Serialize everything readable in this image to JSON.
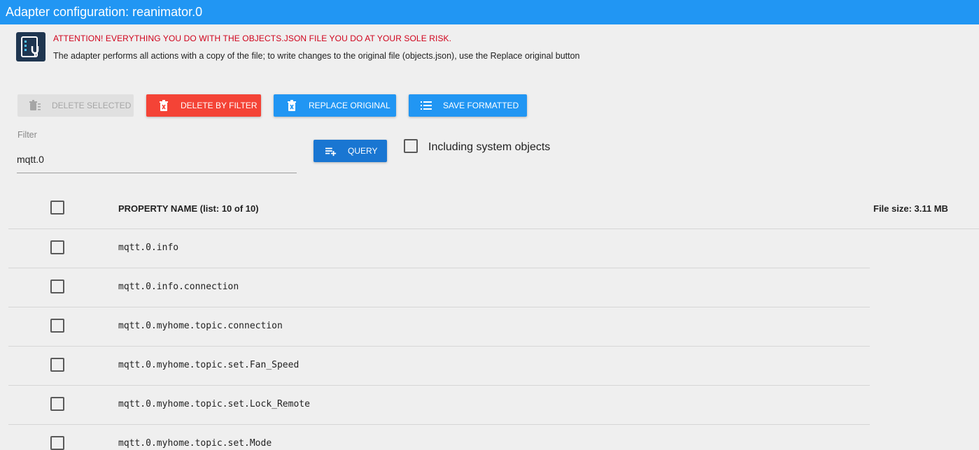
{
  "app": {
    "title": "Adapter configuration: reanimator.0"
  },
  "notice": {
    "attention": "ATTENTION! EVERYTHING YOU DO WITH THE OBJECTS.JSON FILE YOU DO AT YOUR SOLE RISK.",
    "info": "The adapter performs all actions with a copy of the file; to write changes to the original file (objects.json), use the Replace original button"
  },
  "toolbar": {
    "delete_selected": "DELETE SELECTED",
    "delete_by_filter": "DELETE BY FILTER",
    "replace_original": "REPLACE ORIGINAL",
    "save_formatted": "SAVE FORMATTED"
  },
  "filter": {
    "label": "Filter",
    "value": "mqtt.0",
    "query_label": "QUERY",
    "system_objects_label": "Including system objects"
  },
  "table": {
    "header_name": "PROPERTY NAME (list: 10 of 10)",
    "file_size": "File size: 3.11 MB",
    "rows": [
      "mqtt.0.info",
      "mqtt.0.info.connection",
      "mqtt.0.myhome.topic.connection",
      "mqtt.0.myhome.topic.set.Fan_Speed",
      "mqtt.0.myhome.topic.set.Lock_Remote",
      "mqtt.0.myhome.topic.set.Mode"
    ]
  },
  "colors": {
    "titlebar": "#2196f3",
    "danger": "#f44336",
    "primary": "#2196f3",
    "query": "#1976d2"
  }
}
